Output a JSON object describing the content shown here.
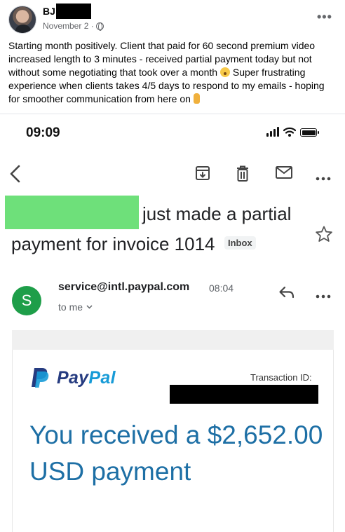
{
  "post": {
    "author": "BJ",
    "date": "November 2 ·",
    "more_label": "•••",
    "text": "Starting month positively. Client that paid for 60 second premium video increased length to 3 minutes - received partial payment today but not without some negotiating that took over a month",
    "text2": " Super frustrating experience when clients takes 4/5 days to respond to my emails - hoping for smoother communication from here on "
  },
  "status_bar": {
    "time": "09:09"
  },
  "email": {
    "subject_line1": "just made a partial",
    "subject_line2": "payment for invoice 1014",
    "label": "Inbox",
    "sender_initial": "S",
    "sender_email": "service@intl.paypal.com",
    "time": "08:04",
    "recipient": "to me",
    "more_label": "•••"
  },
  "paypal": {
    "brand_part1": "Pay",
    "brand_part2": "Pal",
    "transaction_label": "Transaction ID:",
    "headline": "You received a $2,652.00 USD payment",
    "brand_colors": {
      "dark": "#253b80",
      "light": "#179bd7",
      "headline": "#1d6fa5"
    }
  },
  "icons": [
    "globe-icon",
    "back-arrow-icon",
    "archive-icon",
    "trash-icon",
    "mail-icon",
    "more-icon",
    "star-icon",
    "reply-icon",
    "chevron-down-icon",
    "paypal-logo-icon"
  ]
}
